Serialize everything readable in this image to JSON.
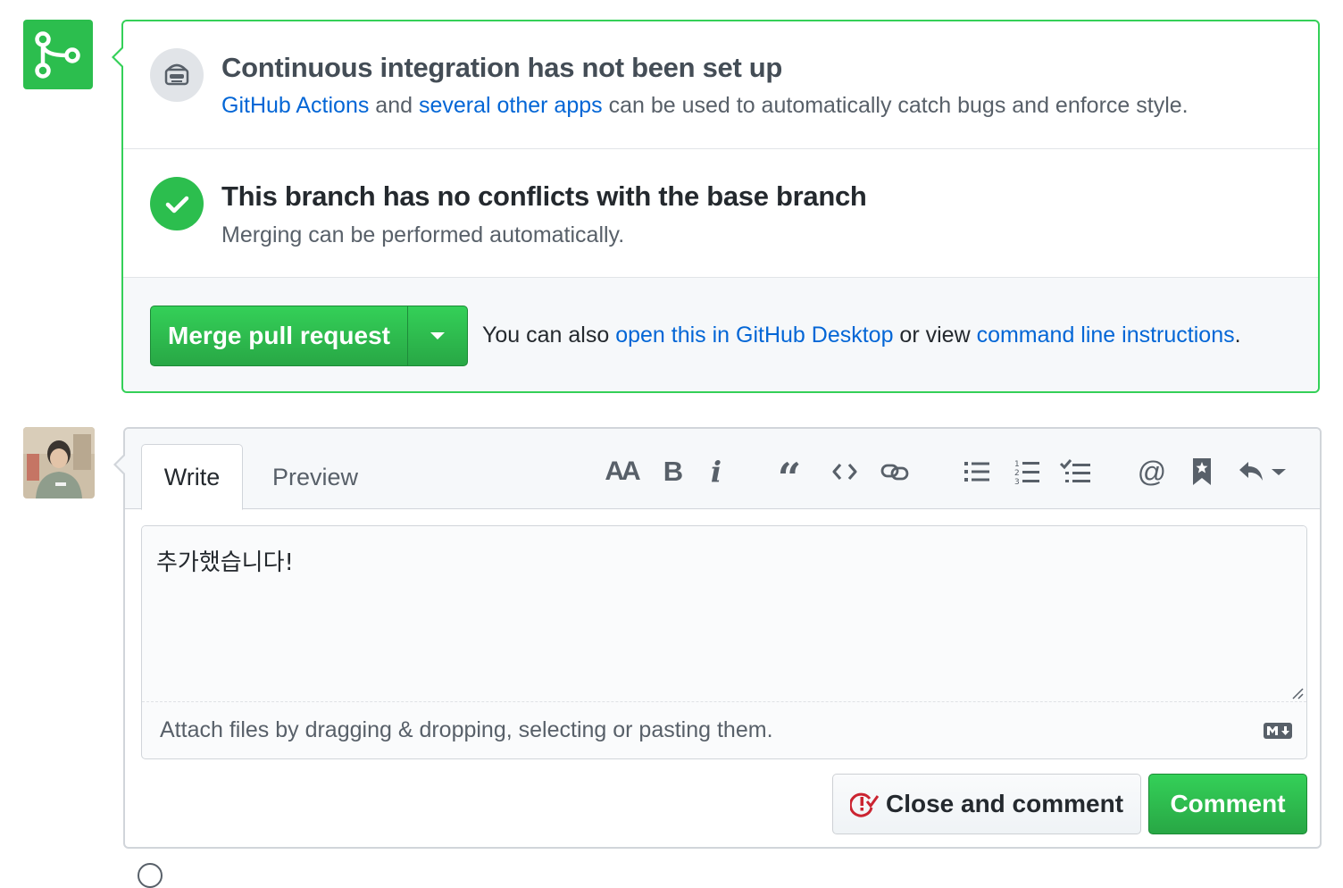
{
  "merge_status": {
    "icon": "git-merge-icon",
    "ci": {
      "icon": "robot-icon",
      "heading": "Continuous integration has not been set up",
      "link_actions": "GitHub Actions",
      "text_and": " and ",
      "link_apps": "several other apps",
      "text_rest": " can be used to automatically catch bugs and enforce style."
    },
    "branch": {
      "icon": "check-icon",
      "heading": "This branch has no conflicts with the base branch",
      "sub": "Merging can be performed automatically."
    },
    "merge": {
      "button_label": "Merge pull request",
      "caret_icon": "triangle-down-icon",
      "note_prefix": "You can also ",
      "link_desktop": "open this in GitHub Desktop",
      "note_middle": " or view ",
      "link_cli": "command line instructions",
      "note_suffix": "."
    }
  },
  "comment_form": {
    "tabs": [
      "Write",
      "Preview"
    ],
    "active_tab": "Write",
    "toolbar": [
      {
        "name": "header",
        "icon": "text-size-icon",
        "label": "AA"
      },
      {
        "name": "bold",
        "icon": "bold-icon",
        "label": "B"
      },
      {
        "name": "italic",
        "icon": "italic-icon",
        "label": "i"
      },
      {
        "name": "quote",
        "icon": "quote-icon",
        "label": "“"
      },
      {
        "name": "code",
        "icon": "code-icon"
      },
      {
        "name": "link",
        "icon": "link-icon"
      },
      {
        "name": "unordered-list",
        "icon": "list-unordered-icon"
      },
      {
        "name": "ordered-list",
        "icon": "list-ordered-icon"
      },
      {
        "name": "task-list",
        "icon": "tasklist-icon"
      },
      {
        "name": "mention",
        "icon": "mention-icon",
        "label": "@"
      },
      {
        "name": "reference",
        "icon": "bookmark-icon"
      },
      {
        "name": "saved-replies",
        "icon": "reply-icon"
      }
    ],
    "textarea_value": "추가했습니다!",
    "attach_hint": "Attach files by dragging & dropping, selecting or pasting them.",
    "markdown_icon": "markdown-icon",
    "close_button": {
      "label": "Close and comment",
      "icon": "issue-closed-icon"
    },
    "comment_button": {
      "label": "Comment"
    }
  },
  "colors": {
    "green": "#2cbe4e",
    "link": "#0366d6",
    "border_green": "#34d058",
    "danger": "#cb2431"
  }
}
